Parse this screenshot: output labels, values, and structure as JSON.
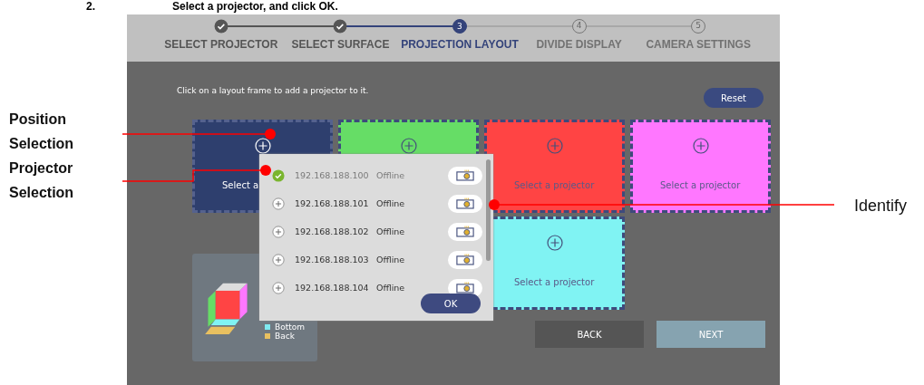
{
  "instruction": {
    "number": "2.",
    "text": "Select a projector, and click OK."
  },
  "callouts": [
    {
      "label": "Position Selection"
    },
    {
      "label": "Projector Selection"
    },
    {
      "label": "Identify"
    }
  ],
  "steps": [
    {
      "label": "SELECT PROJECTOR",
      "completed": true,
      "selected": false
    },
    {
      "label": "SELECT SURFACE",
      "completed": true,
      "selected": false
    },
    {
      "number": "3",
      "label": "PROJECTION LAYOUT",
      "completed": false,
      "selected": true
    },
    {
      "number": "4",
      "label": "DIVIDE DISPLAY",
      "completed": false,
      "selected": false
    },
    {
      "number": "5",
      "label": "CAMERA SETTINGS",
      "completed": false,
      "selected": false
    }
  ],
  "hint": "Click on a layout frame to add a projector to it.",
  "reset_button": "Reset",
  "frames": [
    {
      "color": "#2e3f6e",
      "label": "Select a",
      "selected": true
    },
    {
      "color": "#66dd66",
      "selected": false
    },
    {
      "color": "#ff4444",
      "label": "Select a projector",
      "selected": false
    },
    {
      "color": "#ff77ff",
      "label": "Select a projector",
      "selected": false
    },
    {
      "color": "#80f3f3",
      "label": "Select a projector",
      "selected": false
    }
  ],
  "legend": [
    {
      "label": "Bottom",
      "color": "#7fe9f0"
    },
    {
      "label": "Back",
      "color": "#e8c060"
    }
  ],
  "projectors": [
    {
      "ip": "192.168.188.100",
      "status": "Offline",
      "selected": true
    },
    {
      "ip": "192.168.188.101",
      "status": "Offline",
      "selected": false
    },
    {
      "ip": "192.168.188.102",
      "status": "Offline",
      "selected": false
    },
    {
      "ip": "192.168.188.103",
      "status": "Offline",
      "selected": false
    },
    {
      "ip": "192.168.188.104",
      "status": "Offline",
      "selected": false
    }
  ],
  "ok_button": "OK",
  "back_button": "BACK",
  "next_button": "NEXT"
}
